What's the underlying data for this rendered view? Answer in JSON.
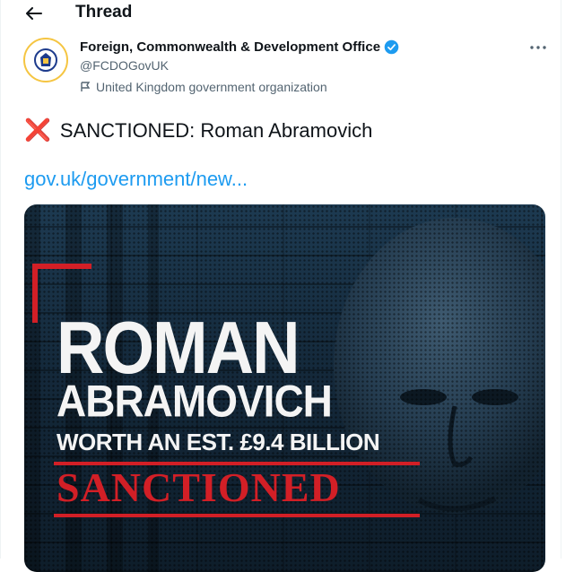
{
  "header": {
    "title": "Thread"
  },
  "tweet": {
    "author_name": "Foreign, Commonwealth & Development Office",
    "handle": "@FCDOGovUK",
    "affiliation": "United Kingdom government organization",
    "text": "SANCTIONED: Roman Abramovich",
    "link": "gov.uk/government/new..."
  },
  "media": {
    "line1": "ROMAN",
    "line2": "ABRAMOVICH",
    "line3": "WORTH AN EST. £9.4 BILLION",
    "stamp": "SANCTIONED"
  },
  "icons": {
    "back": "arrow-left-icon",
    "verified": "verified-badge-icon",
    "more": "more-options-icon",
    "affiliation": "government-flag-icon",
    "cross": "cross-mark-icon"
  },
  "colors": {
    "link": "#1d9bf0",
    "verified": "#1d9bf0",
    "cross": "#e0232e",
    "stamp": "#d21f26",
    "secondary_text": "#536471"
  }
}
